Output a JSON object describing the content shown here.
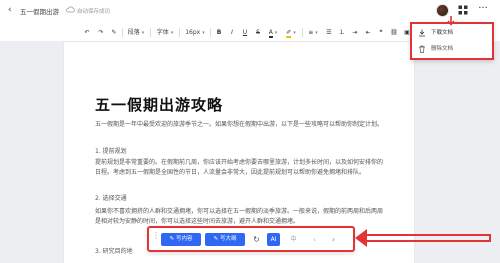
{
  "header": {
    "doc_title": "五一假期出游",
    "save_status": "自动保存成功"
  },
  "toolbar": {
    "paragraph_label": "段落",
    "font_label": "字体",
    "size_label": "16px",
    "bold": "B",
    "italic": "I",
    "underline": "U",
    "strike": "S"
  },
  "menu": {
    "download_label": "下载文档",
    "delete_label": "删除文档"
  },
  "document": {
    "title": "五一假期出游攻略",
    "intro": "五一假期是一年中最受欢迎的旅游季节之一。如果你想在假期中出游，以下是一些攻略可以帮助你制定计划。",
    "section1_heading": "1. 提前规划",
    "section1_body": "提前规划是非常重要的。在假期前几周，你应该开始考虑你要去哪里旅游，计划多长时间，以及如何安排你的日程。考虑到五一假期是全国性的节日，人流量会非常大，因此提前规划可以帮助你避免拥堵和排队。",
    "section2_heading": "2. 选择交通",
    "section2_body": "如果你不喜欢拥挤的人群和交通拥堵，你可以选择在五一假期的淡季旅游。一般来说，假期的前两周和后两周是相对较为安静的时间，你可以选择这些时间去旅游，避开人群和交通拥堵。",
    "section3_heading": "3. 研究目的地"
  },
  "bottom": {
    "continue_label": "写内容",
    "polish_label": "写大纲",
    "ai_badge": "AI",
    "lang_label": "中"
  }
}
